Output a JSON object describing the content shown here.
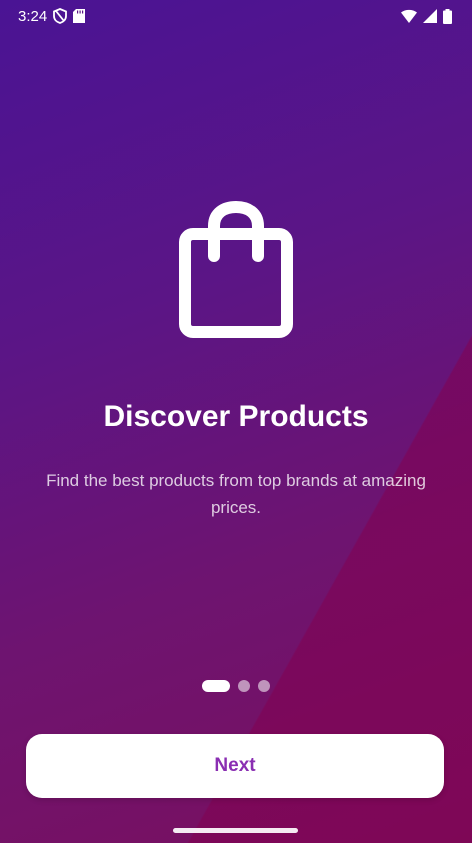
{
  "status_bar": {
    "time": "3:24",
    "icons": [
      "shield-icon",
      "sd-card-icon",
      "wifi-icon",
      "signal-icon",
      "battery-icon"
    ]
  },
  "onboarding": {
    "icon": "shopping-bag-icon",
    "title": "Discover Products",
    "subtitle": "Find the best products from top brands at amazing prices.",
    "page_indicator": {
      "total": 3,
      "active_index": 0
    },
    "next_label": "Next"
  },
  "colors": {
    "gradient_top": "#4a1494",
    "gradient_bottom": "#7a0f5e",
    "button_bg": "#ffffff",
    "button_text": "#8a2eb2"
  }
}
